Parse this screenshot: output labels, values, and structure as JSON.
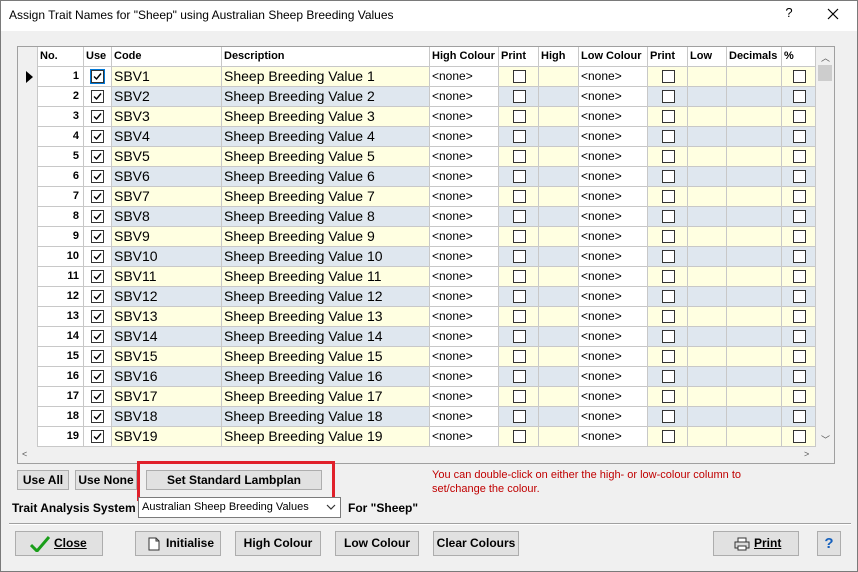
{
  "window": {
    "title": "Assign Trait Names for \"Sheep\" using Australian Sheep Breeding Values",
    "help": "?"
  },
  "columns": [
    "No.",
    "Use",
    "Code",
    "Description",
    "High Colour",
    "Print",
    "High",
    "Low Colour",
    "Print",
    "Low",
    "Decimals",
    "%"
  ],
  "rows": [
    {
      "no": "1",
      "use": true,
      "code": "SBV1",
      "description": "Sheep Breeding Value 1",
      "high_colour": "<none>",
      "low_colour": "<none>"
    },
    {
      "no": "2",
      "use": true,
      "code": "SBV2",
      "description": "Sheep Breeding Value 2",
      "high_colour": "<none>",
      "low_colour": "<none>"
    },
    {
      "no": "3",
      "use": true,
      "code": "SBV3",
      "description": "Sheep Breeding Value 3",
      "high_colour": "<none>",
      "low_colour": "<none>"
    },
    {
      "no": "4",
      "use": true,
      "code": "SBV4",
      "description": "Sheep Breeding Value 4",
      "high_colour": "<none>",
      "low_colour": "<none>"
    },
    {
      "no": "5",
      "use": true,
      "code": "SBV5",
      "description": "Sheep Breeding Value 5",
      "high_colour": "<none>",
      "low_colour": "<none>"
    },
    {
      "no": "6",
      "use": true,
      "code": "SBV6",
      "description": "Sheep Breeding Value 6",
      "high_colour": "<none>",
      "low_colour": "<none>"
    },
    {
      "no": "7",
      "use": true,
      "code": "SBV7",
      "description": "Sheep Breeding Value 7",
      "high_colour": "<none>",
      "low_colour": "<none>"
    },
    {
      "no": "8",
      "use": true,
      "code": "SBV8",
      "description": "Sheep Breeding Value 8",
      "high_colour": "<none>",
      "low_colour": "<none>"
    },
    {
      "no": "9",
      "use": true,
      "code": "SBV9",
      "description": "Sheep Breeding Value 9",
      "high_colour": "<none>",
      "low_colour": "<none>"
    },
    {
      "no": "10",
      "use": true,
      "code": "SBV10",
      "description": "Sheep Breeding Value 10",
      "high_colour": "<none>",
      "low_colour": "<none>"
    },
    {
      "no": "11",
      "use": true,
      "code": "SBV11",
      "description": "Sheep Breeding Value 11",
      "high_colour": "<none>",
      "low_colour": "<none>"
    },
    {
      "no": "12",
      "use": true,
      "code": "SBV12",
      "description": "Sheep Breeding Value 12",
      "high_colour": "<none>",
      "low_colour": "<none>"
    },
    {
      "no": "13",
      "use": true,
      "code": "SBV13",
      "description": "Sheep Breeding Value 13",
      "high_colour": "<none>",
      "low_colour": "<none>"
    },
    {
      "no": "14",
      "use": true,
      "code": "SBV14",
      "description": "Sheep Breeding Value 14",
      "high_colour": "<none>",
      "low_colour": "<none>"
    },
    {
      "no": "15",
      "use": true,
      "code": "SBV15",
      "description": "Sheep Breeding Value 15",
      "high_colour": "<none>",
      "low_colour": "<none>"
    },
    {
      "no": "16",
      "use": true,
      "code": "SBV16",
      "description": "Sheep Breeding Value 16",
      "high_colour": "<none>",
      "low_colour": "<none>"
    },
    {
      "no": "17",
      "use": true,
      "code": "SBV17",
      "description": "Sheep Breeding Value 17",
      "high_colour": "<none>",
      "low_colour": "<none>"
    },
    {
      "no": "18",
      "use": true,
      "code": "SBV18",
      "description": "Sheep Breeding Value 18",
      "high_colour": "<none>",
      "low_colour": "<none>"
    },
    {
      "no": "19",
      "use": true,
      "code": "SBV19",
      "description": "Sheep Breeding Value 19",
      "high_colour": "<none>",
      "low_colour": "<none>"
    }
  ],
  "buttons": {
    "use_all": "Use All",
    "use_none": "Use None",
    "set_standard": "Set Standard Lambplan",
    "close": "Close",
    "initialise": "Initialise",
    "high_colour": "High Colour",
    "low_colour": "Low Colour",
    "clear_colours": "Clear Colours",
    "print": "Print",
    "help": "?"
  },
  "hint": "You can double-click on either the high- or low-colour column to set/change the colour.",
  "trait_analysis": {
    "label": "Trait Analysis System",
    "selected": "Australian Sheep Breeding Values",
    "for_label": "For \"Sheep\""
  },
  "colors": {
    "row_yellow": "#ffffe1",
    "row_blue": "#dfe7ef",
    "highlight": "#e0202a",
    "hint_text": "#c00000",
    "check_green": "#1a9e1a",
    "help_blue": "#1560bd"
  }
}
